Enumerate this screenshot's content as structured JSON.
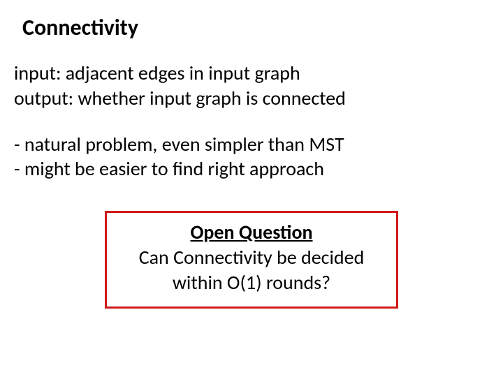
{
  "title": "Connectivity",
  "io": {
    "input": "input: adjacent edges in input graph",
    "output": "output: whether input graph is connected"
  },
  "bullets": {
    "line1": "- natural problem, even simpler than MST",
    "line2": "- might be easier to find right approach"
  },
  "open": {
    "heading": "Open Question",
    "body1": "Can Connectivity be decided",
    "body2": "within O(1) rounds?"
  }
}
